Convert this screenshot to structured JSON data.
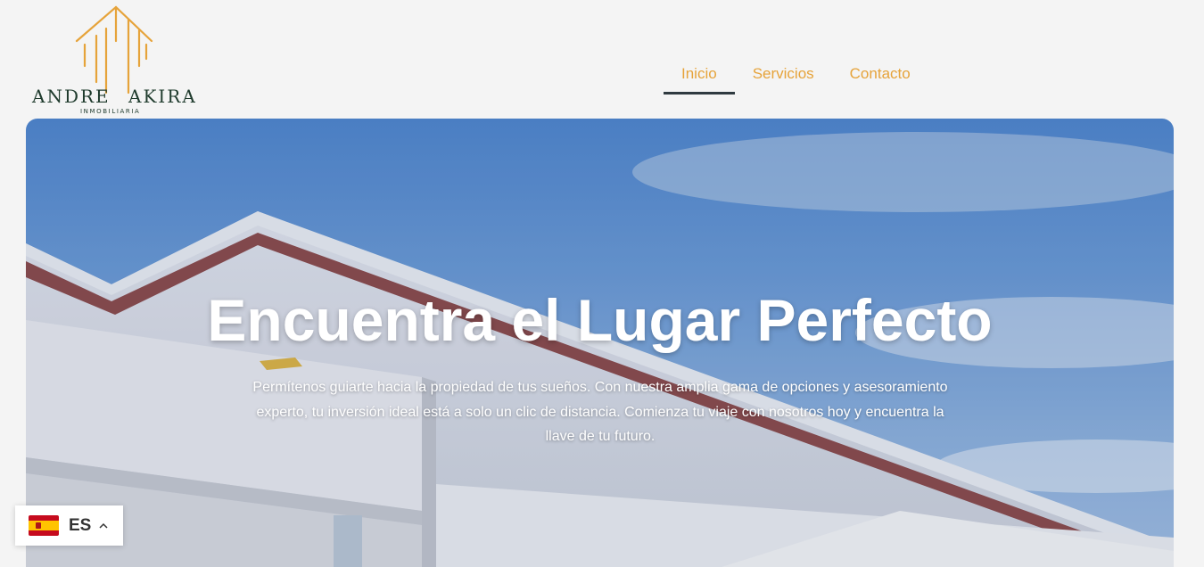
{
  "brand": {
    "name_left": "ANDRE",
    "name_right": "AKIRA",
    "tagline": "INMOBILIARIA",
    "accent_color": "#e6a33a",
    "text_color": "#1f3b2d"
  },
  "nav": {
    "items": [
      {
        "label": "Inicio",
        "active": true
      },
      {
        "label": "Servicios",
        "active": false
      },
      {
        "label": "Contacto",
        "active": false
      }
    ]
  },
  "hero": {
    "title": "Encuentra el Lugar Perfecto",
    "description": "Permítenos guiarte hacia la propiedad de tus sueños. Con nuestra amplia gama de opciones y asesoramiento experto, tu inversión ideal está a solo un clic de distancia. Comienza tu viaje con nosotros hoy y encuentra la llave de tu futuro."
  },
  "language": {
    "code": "ES",
    "flag": "spain-flag-icon"
  }
}
